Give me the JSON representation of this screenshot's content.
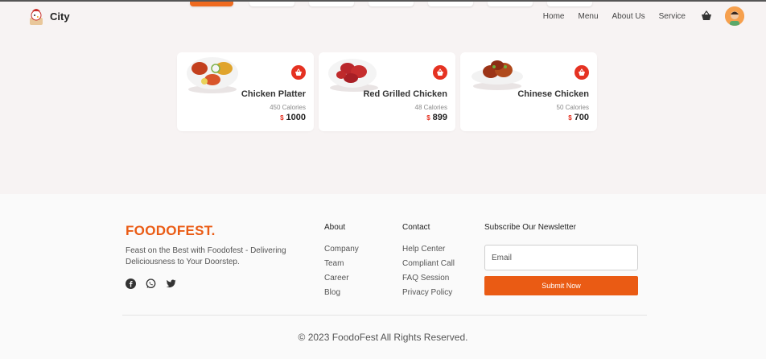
{
  "header": {
    "brand_name": "City",
    "nav": [
      "Home",
      "Menu",
      "About Us",
      "Service"
    ]
  },
  "colors": {
    "accent": "#ea5b14",
    "badge": "#e53222"
  },
  "icons": {
    "cart": "basket-icon",
    "social": [
      "facebook-icon",
      "whatsapp-icon",
      "twitter-icon"
    ]
  },
  "products": [
    {
      "name": "Chicken Platter",
      "calories": "450 Calories",
      "currency": "$",
      "price": "1000"
    },
    {
      "name": "Red Grilled Chicken",
      "calories": "48 Calories",
      "currency": "$",
      "price": "899"
    },
    {
      "name": "Chinese Chicken",
      "calories": "50 Calories",
      "currency": "$",
      "price": "700"
    }
  ],
  "footer": {
    "brand": "FOODOFEST.",
    "description": "Feast on the Best with Foodofest - Delivering Deliciousness to Your Doorstep.",
    "about": {
      "title": "About",
      "links": [
        "Company",
        "Team",
        "Career",
        "Blog"
      ]
    },
    "contact": {
      "title": "Contact",
      "links": [
        "Help Center",
        "Compliant Call",
        "FAQ Session",
        "Privacy Policy"
      ]
    },
    "newsletter": {
      "title": "Subscribe Our Newsletter",
      "email_placeholder": "Email",
      "button": "Submit Now"
    },
    "copyright": "© 2023 FoodoFest All Rights Reserved."
  }
}
